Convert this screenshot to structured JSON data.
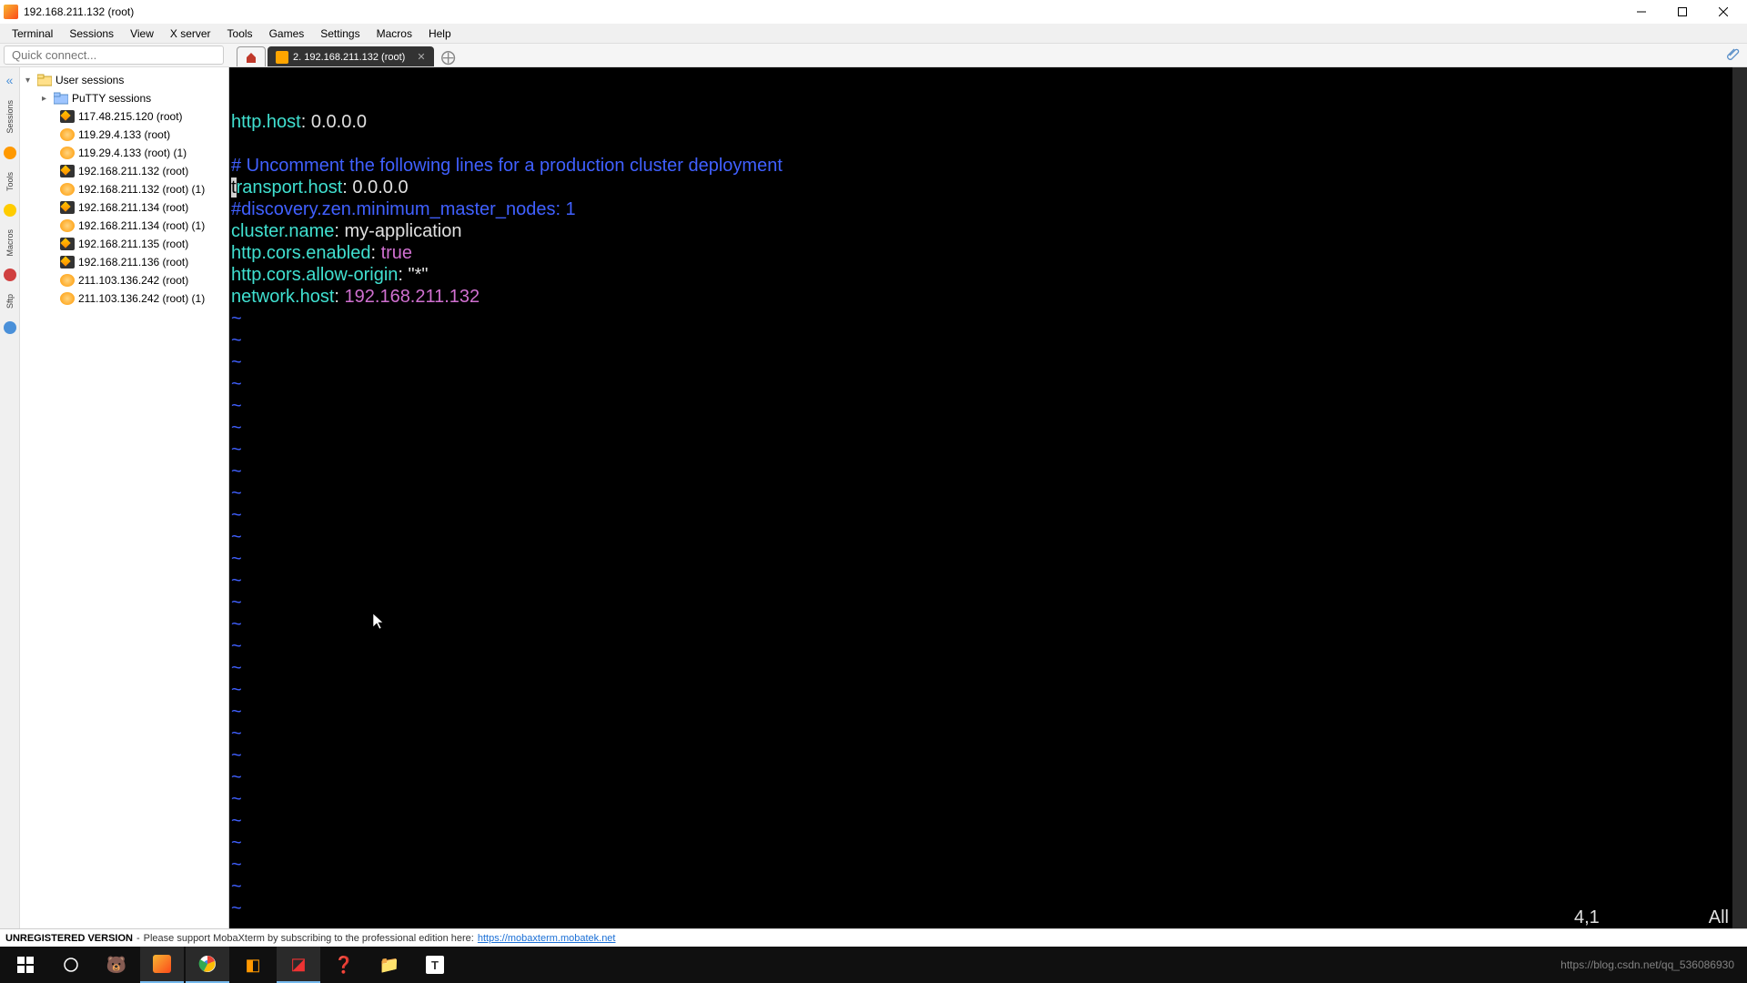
{
  "window": {
    "title": "192.168.211.132 (root)"
  },
  "menu": [
    "Terminal",
    "Sessions",
    "View",
    "X server",
    "Tools",
    "Games",
    "Settings",
    "Macros",
    "Help"
  ],
  "quickconnect_placeholder": "Quick connect...",
  "tabs": {
    "active": {
      "label": "2. 192.168.211.132 (root)"
    }
  },
  "sidebar": {
    "root": "User sessions",
    "putty": "PuTTY sessions",
    "items": [
      {
        "label": "117.48.215.120 (root)",
        "icon": "y"
      },
      {
        "label": "119.29.4.133 (root)",
        "icon": "o"
      },
      {
        "label": "119.29.4.133 (root) (1)",
        "icon": "o"
      },
      {
        "label": "192.168.211.132 (root)",
        "icon": "y"
      },
      {
        "label": "192.168.211.132 (root) (1)",
        "icon": "o"
      },
      {
        "label": "192.168.211.134 (root)",
        "icon": "y"
      },
      {
        "label": "192.168.211.134 (root) (1)",
        "icon": "o"
      },
      {
        "label": "192.168.211.135 (root)",
        "icon": "y"
      },
      {
        "label": "192.168.211.136 (root)",
        "icon": "y"
      },
      {
        "label": "211.103.136.242 (root)",
        "icon": "o"
      },
      {
        "label": "211.103.136.242 (root) (1)",
        "icon": "o"
      }
    ]
  },
  "rail": {
    "items": [
      "Sessions",
      "Tools",
      "Macros",
      "Sftp"
    ]
  },
  "terminal": {
    "lines": [
      {
        "segs": [
          {
            "c": "t-cyan",
            "t": "http.host"
          },
          {
            "c": "t-white",
            "t": ": 0.0.0.0"
          }
        ]
      },
      {
        "segs": []
      },
      {
        "segs": [
          {
            "c": "t-blue",
            "t": "# Uncomment the following lines for a production cluster deployment"
          }
        ]
      },
      {
        "segs": [
          {
            "c": "cursor-block",
            "t": "t"
          },
          {
            "c": "t-cyan",
            "t": "ransport.host"
          },
          {
            "c": "t-white",
            "t": ": 0.0.0.0"
          }
        ]
      },
      {
        "segs": [
          {
            "c": "t-blue",
            "t": "#discovery.zen.minimum_master_nodes: 1"
          }
        ]
      },
      {
        "segs": [
          {
            "c": "t-cyan",
            "t": "cluster.name"
          },
          {
            "c": "t-white",
            "t": ": my-application"
          }
        ]
      },
      {
        "segs": [
          {
            "c": "t-cyan",
            "t": "http.cors.enabled"
          },
          {
            "c": "t-white",
            "t": ": "
          },
          {
            "c": "t-mag",
            "t": "true"
          }
        ]
      },
      {
        "segs": [
          {
            "c": "t-cyan",
            "t": "http.cors.allow-origin"
          },
          {
            "c": "t-white",
            "t": ": \"*\""
          }
        ]
      },
      {
        "segs": [
          {
            "c": "t-cyan",
            "t": "network.host"
          },
          {
            "c": "t-white",
            "t": ": "
          },
          {
            "c": "t-mag",
            "t": "192.168.211.132"
          }
        ]
      }
    ],
    "tilde_count": 29,
    "tilde_char": "~",
    "status_pos": "4,1",
    "status_all": "All"
  },
  "footer": {
    "unreg": "UNREGISTERED VERSION",
    "sep": " - ",
    "msg": "Please support MobaXterm by subscribing to the professional edition here: ",
    "link": "https://mobaxterm.mobatek.net"
  },
  "tray": {
    "watermark": "https://blog.csdn.net/qq_536086930"
  }
}
